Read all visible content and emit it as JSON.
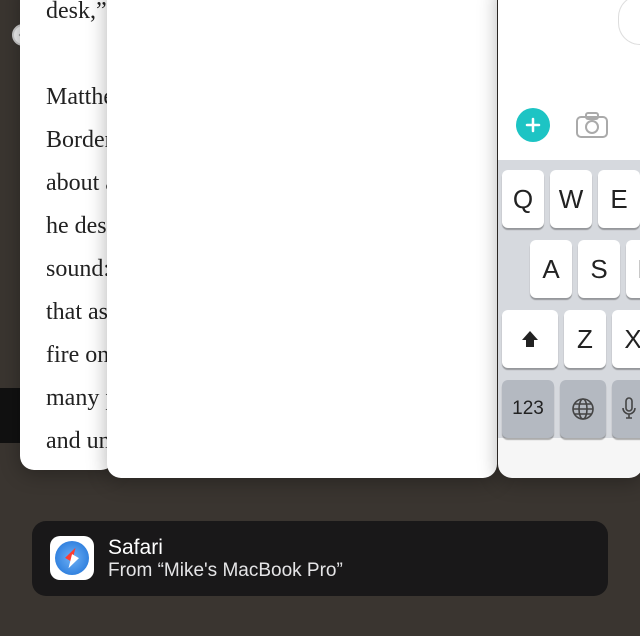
{
  "reader": {
    "lines": [
      "desk,” s",
      "",
      "Matthe",
      "Borderl",
      "about a",
      "he desc",
      "sound:",
      "that as",
      "fire on",
      "many p",
      "and un"
    ]
  },
  "keyboard": {
    "row1": [
      "Q",
      "W",
      "E"
    ],
    "row2": [
      "A",
      "S",
      "D"
    ],
    "row3": [
      "Z",
      "X"
    ],
    "num_key": "123"
  },
  "handoff": {
    "app": "Safari",
    "from": "From “Mike's MacBook Pro”"
  },
  "icons": {
    "plus": "plus-icon",
    "camera": "camera-icon",
    "shift": "shift-icon",
    "globe": "globe-icon",
    "mic": "mic-icon",
    "back": "back-chevron"
  }
}
